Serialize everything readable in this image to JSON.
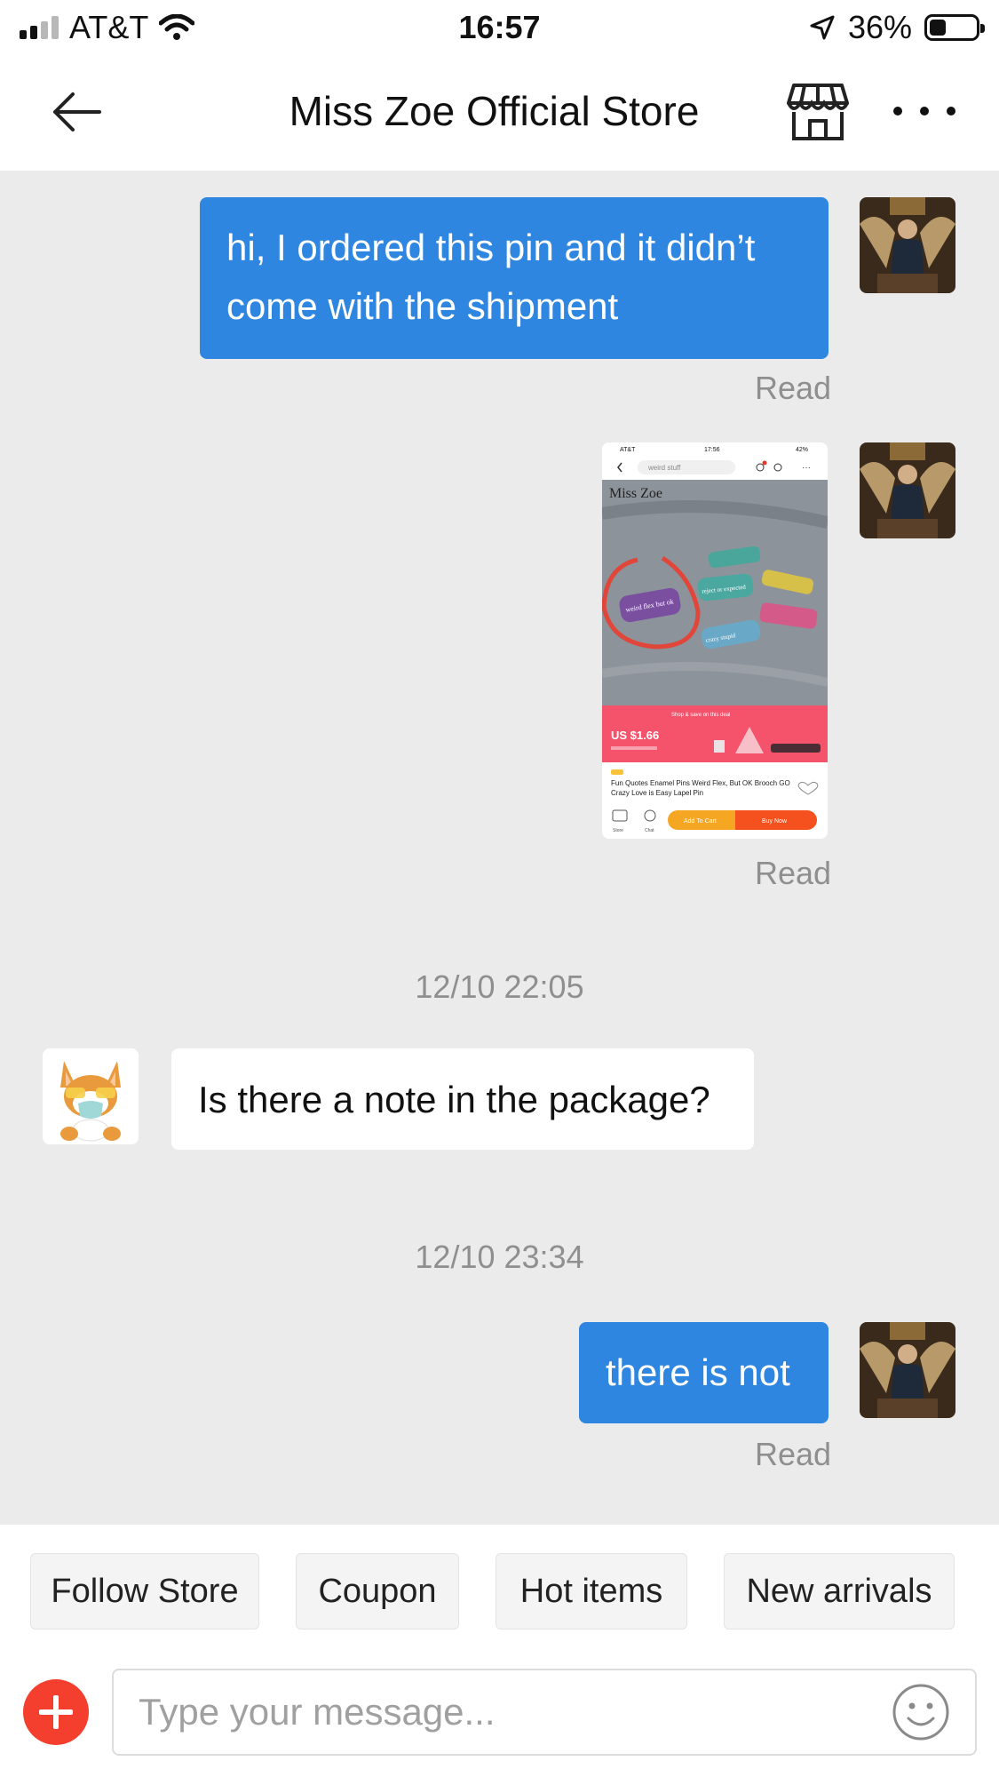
{
  "status_bar": {
    "carrier": "AT&T",
    "time": "16:57",
    "battery": "36%",
    "battery_level": 0.36
  },
  "header": {
    "title": "Miss Zoe Official Store",
    "icons": [
      "back-arrow-icon",
      "store-icon",
      "more-icon"
    ]
  },
  "messages": [
    {
      "type": "outgoing",
      "text": "hi, I ordered this pin and it didn’t come with the shipment",
      "status": "Read"
    },
    {
      "type": "outgoing_image",
      "status": "Read",
      "image": {
        "carrier": "AT&T",
        "time": "17:56",
        "battery": "42%",
        "search_placeholder": "weird stuff",
        "store_name": "Miss Zoe",
        "pins": [
          "weird flex but ok",
          "reject or expected",
          "crazy stupid"
        ],
        "promo": "Shop & save on this deal",
        "price": "US $1.66",
        "product_title": "Fun Quotes Enamel Pins Weird Flex, But OK Brooch GO Crazy Love is Easy Lapel Pin",
        "nav_store": "Store",
        "nav_chat": "Chat",
        "add_to_cart": "Add To Cart",
        "buy_now": "Buy Now"
      }
    },
    {
      "type": "timestamp",
      "text": "12/10 22:05"
    },
    {
      "type": "incoming",
      "text": "Is there a note in the package?"
    },
    {
      "type": "timestamp",
      "text": "12/10 23:34"
    },
    {
      "type": "outgoing",
      "text": "there is not",
      "status": "Read"
    }
  ],
  "quick_actions": [
    "Follow Store",
    "Coupon",
    "Hot items",
    "New arrivals"
  ],
  "input": {
    "placeholder": "Type your message...",
    "value": ""
  },
  "colors": {
    "outgoing_bubble": "#2f86e0",
    "chat_bg": "#ebebeb",
    "plus_button": "#f43f2e",
    "price_banner": "#f5526b",
    "add_to_cart": "#f5a623",
    "buy_now": "#f4511e"
  }
}
